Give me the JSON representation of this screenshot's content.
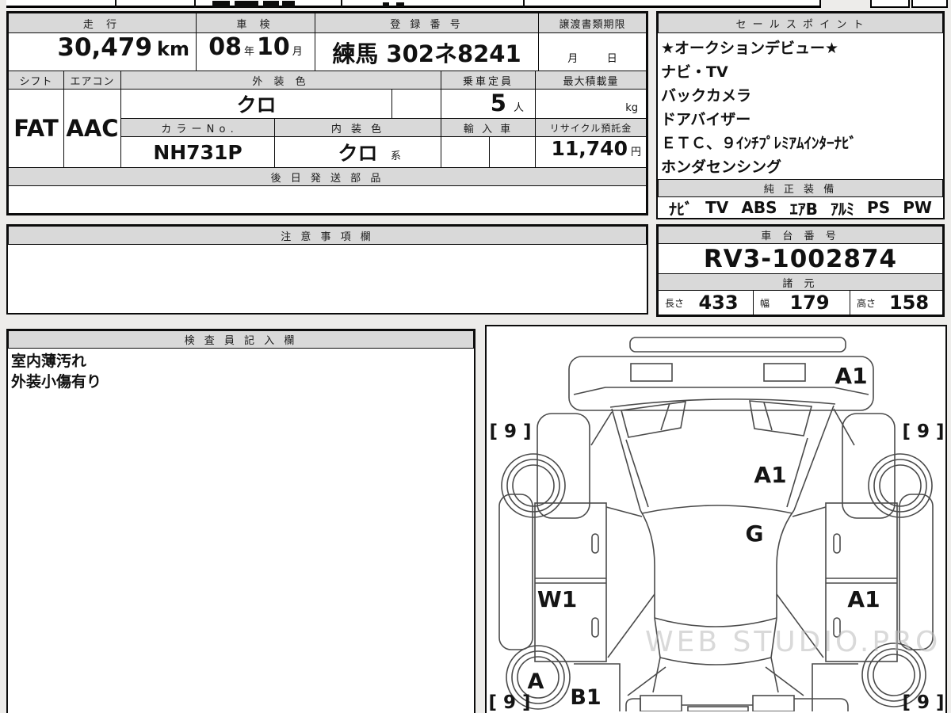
{
  "colors": {
    "header_bg": "#d9d9d9",
    "border": "#0c0c0c",
    "paper": "#ffffff",
    "page_bg": "#edecea",
    "watermark": "#bcbcbc"
  },
  "table": {
    "mileage_label": "走 行",
    "mileage_value": "30,479",
    "mileage_unit": "km",
    "shaken_label": "車 検",
    "shaken_year": "08",
    "shaken_year_unit": "年",
    "shaken_month": "10",
    "shaken_month_unit": "月",
    "registration_label": "登 録 番 号",
    "registration_value": "練馬 302ネ8241",
    "transfer_label": "譲渡書類期限",
    "transfer_month_unit": "月",
    "transfer_day_unit": "日",
    "shift_label": "シフト",
    "shift_value": "FAT",
    "aircon_label": "エアコン",
    "aircon_value": "AAC",
    "exterior_label": "外 装 色",
    "exterior_value": "クロ",
    "capacity_label": "乗車定員",
    "capacity_value": "5",
    "capacity_unit": "人",
    "max_load_label": "最大積載量",
    "max_load_unit": "kg",
    "color_no_label": "カ ラ ー N o .",
    "color_no_value": "NH731P",
    "interior_label": "内 装 色",
    "interior_value": "クロ",
    "interior_suffix": "系",
    "import_label": "輸 入 車",
    "recycle_label": "リサイクル預託金",
    "recycle_value": "11,740",
    "recycle_unit": "円",
    "later_parts_label": "後 日 発 送 部 品"
  },
  "sales": {
    "title": "セ ー ル ス ポ イ ン ト",
    "lines": [
      "★オークションデビュー★",
      "ナビ・TV",
      "バックカメラ",
      "ドアバイザー",
      "ＥＴＣ、９ｲﾝﾁﾌﾟﾚﾐｱﾑｲﾝﾀｰﾅﾋﾞ",
      "ホンダセンシング"
    ]
  },
  "equipment": {
    "title": "純 正 装 備",
    "items": [
      "ﾅﾋﾞ",
      "TV",
      "ABS",
      "ｴｱB",
      "ｱﾙﾐ",
      "PS",
      "PW"
    ]
  },
  "notes": {
    "title": "注 意 事 項 欄",
    "value": ""
  },
  "chassis": {
    "title": "車 台 番 号",
    "value": "RV3-1002874"
  },
  "specs": {
    "title": "諸 元",
    "length_label": "長さ",
    "length_value": "433",
    "width_label": "幅",
    "width_value": "179",
    "height_label": "高さ",
    "height_value": "158"
  },
  "inspector": {
    "title": "検 査 員 記 入 欄",
    "lines": [
      "室内薄汚れ",
      "外装小傷有り"
    ]
  },
  "diagram": {
    "watermark": "WEB STUDIO.PRO",
    "front_bumper_grade": "A1",
    "hood_grade": "A1",
    "windshield_grade": "G",
    "left_door_grade": "W1",
    "right_door_grade": "A1",
    "rear_left_wheel_grade": "A",
    "rear_left_quarter_grade": "B1",
    "tire_front_left": "[ 9 ]",
    "tire_front_right": "[ 9 ]",
    "tire_rear_left": "[ 9 ]",
    "tire_rear_right": "[ 9 ]"
  }
}
